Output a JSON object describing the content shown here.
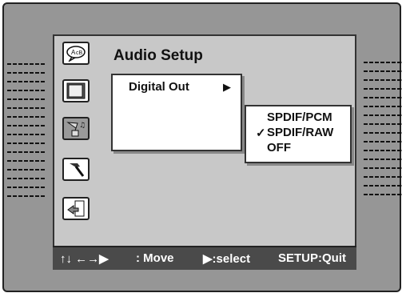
{
  "menu": {
    "title": "Audio Setup",
    "icons": [
      "speech-bubble-icon",
      "tv-display-icon",
      "gramophone-icon",
      "hammer-icon",
      "exit-door-icon"
    ],
    "active_icon": "gramophone-icon"
  },
  "submenu": {
    "item_label": "Digital Out",
    "arrow": "▶"
  },
  "options": {
    "items": [
      "SPDIF/PCM",
      "SPDIF/RAW",
      "OFF"
    ],
    "selected": "SPDIF/RAW",
    "check_mark": "✓"
  },
  "statusbar": {
    "move_arrows": "↑↓ ←→▶",
    "move_label": ": Move",
    "select_label": "▶:select",
    "quit_label": "SETUP:Quit"
  },
  "colors": {
    "outer_frame": "#969696",
    "screen": "#c8c8c8",
    "statusbar": "#4a4a4a",
    "highlight": "#9a9a9a"
  }
}
